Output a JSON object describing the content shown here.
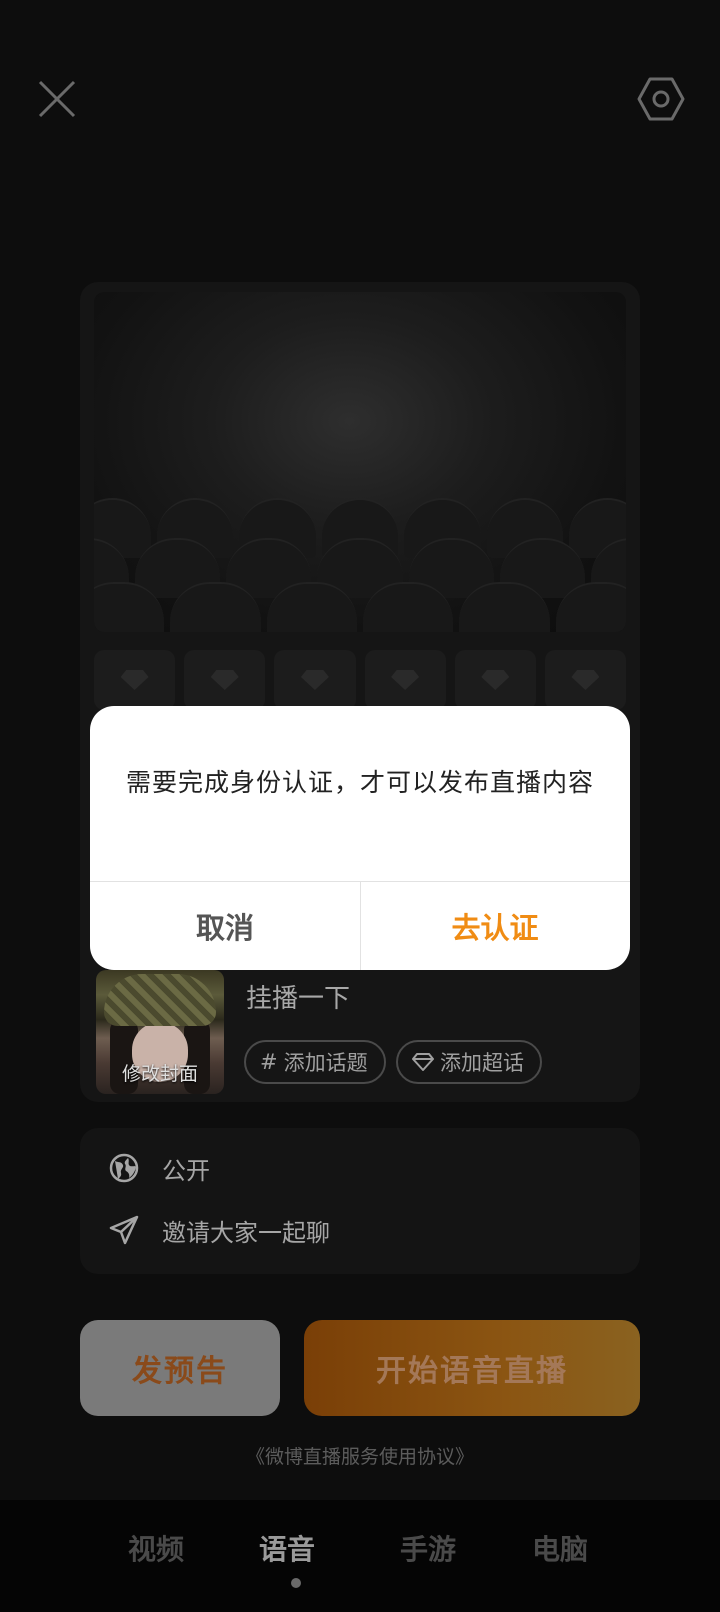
{
  "header": {
    "close_icon": "close-icon",
    "settings_icon": "settings-hexagon-icon"
  },
  "cover": {
    "edit_label": "修改封面"
  },
  "room": {
    "title": "挂播一下",
    "tags": [
      {
        "icon": "hash-icon",
        "label": "添加话题"
      },
      {
        "icon": "diamond-icon",
        "label": "添加超话"
      }
    ]
  },
  "settings": {
    "visibility": {
      "icon": "globe-icon",
      "label": "公开"
    },
    "invite": {
      "icon": "paper-plane-icon",
      "label": "邀请大家一起聊"
    }
  },
  "actions": {
    "preview_label": "发预告",
    "start_label": "开始语音直播",
    "agreement": "《微博直播服务使用协议》"
  },
  "tabs": [
    {
      "label": "视频",
      "active": false
    },
    {
      "label": "语音",
      "active": true
    },
    {
      "label": "手游",
      "active": false
    },
    {
      "label": "电脑",
      "active": false
    }
  ],
  "dialog": {
    "message": "需要完成身份认证，才可以发布直播内容",
    "cancel_label": "取消",
    "confirm_label": "去认证",
    "confirm_color": "#f08c14"
  },
  "colors": {
    "accent": "#f08c14",
    "background": "#0d0d0d"
  }
}
